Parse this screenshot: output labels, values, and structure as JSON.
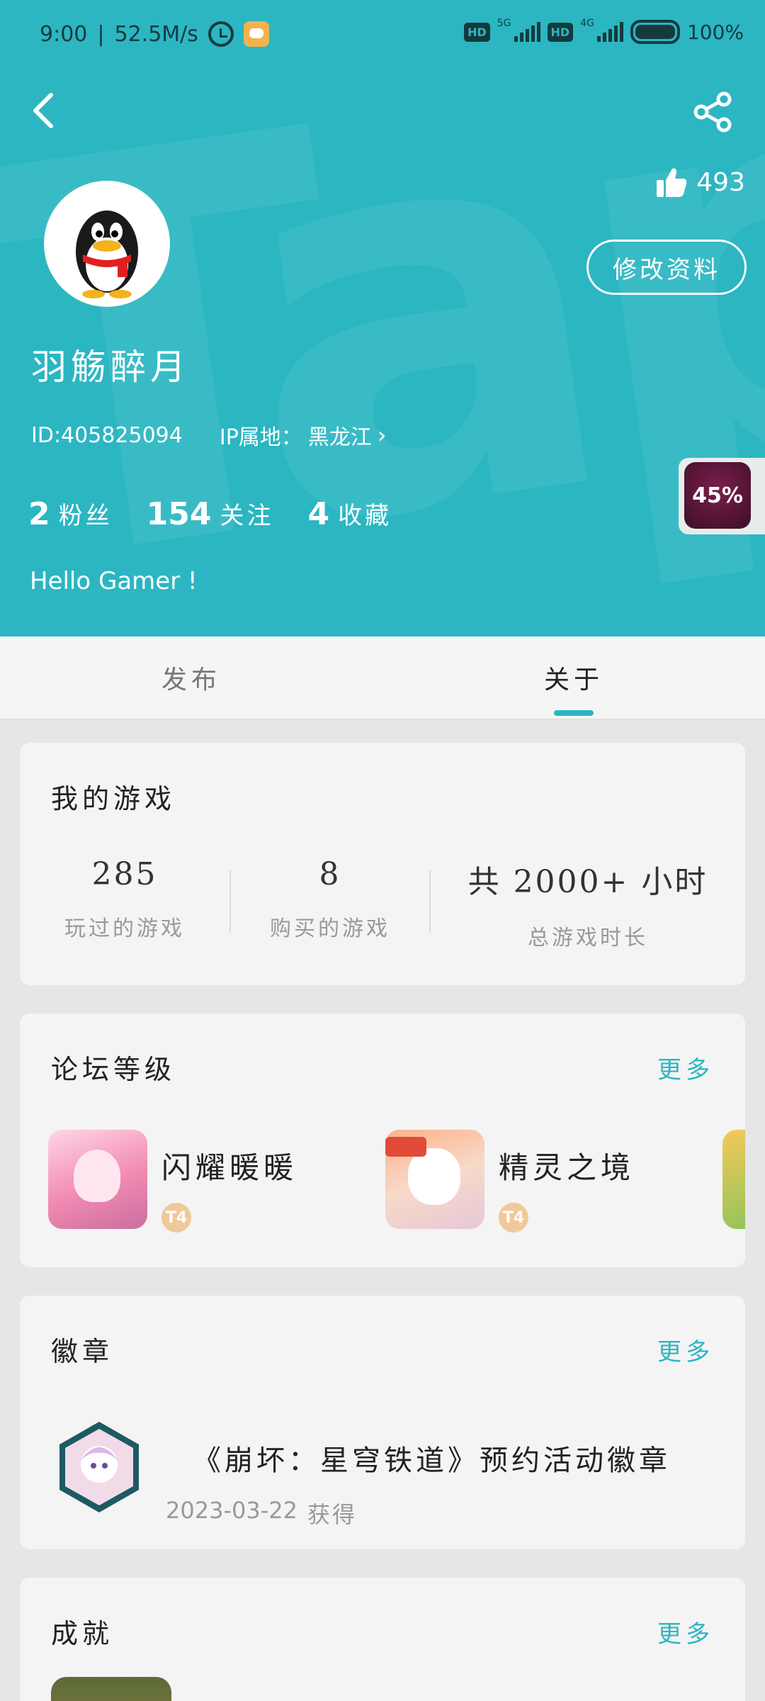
{
  "status_bar": {
    "time": "9:00",
    "speed": "52.5M/s",
    "net1": "5G",
    "net2": "4G",
    "hd": "HD",
    "battery": "100%"
  },
  "profile": {
    "likes": "493",
    "edit_label": "修改资料",
    "username": "羽觞醉月",
    "id_text": "ID:405825094",
    "ip_label": "IP属地：",
    "ip_location": "黑龙江",
    "followers_count": "2",
    "followers_label": "粉丝",
    "following_count": "154",
    "following_label": "关注",
    "favorites_count": "4",
    "favorites_label": "收藏",
    "bio": "Hello Gamer !",
    "progress_text": "45%",
    "progress_value": 45
  },
  "tabs": [
    {
      "label": "发布",
      "active": false
    },
    {
      "label": "关于",
      "active": true
    }
  ],
  "my_games": {
    "title": "我的游戏",
    "played_value": "285",
    "played_label": "玩过的游戏",
    "bought_value": "8",
    "bought_label": "购买的游戏",
    "hours_value": "共 2000+ 小时",
    "hours_label": "总游戏时长"
  },
  "forum": {
    "title": "论坛等级",
    "more": "更多",
    "items": [
      {
        "name": "闪耀暖暖",
        "level": "T4"
      },
      {
        "name": "精灵之境",
        "level": "T4"
      }
    ]
  },
  "badges": {
    "title": "徽章",
    "more": "更多",
    "badge_title": "《崩坏：星穹铁道》预约活动徽章",
    "date": "2023-03-22",
    "obtained": "获得"
  },
  "achievements": {
    "title": "成就",
    "more": "更多"
  },
  "colors": {
    "header_bg": "#2bb6c2",
    "accent": "#2bb6c2"
  }
}
